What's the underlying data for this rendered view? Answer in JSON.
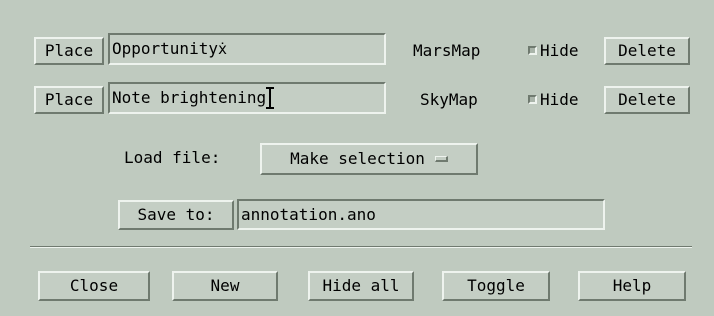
{
  "rows": [
    {
      "place_label": "Place",
      "annotation_text": "Opportunity",
      "map_label": "MarsMap",
      "hide_label": "Hide",
      "delete_label": "Delete"
    },
    {
      "place_label": "Place",
      "annotation_text": "Note brightening",
      "map_label": "SkyMap",
      "hide_label": "Hide",
      "delete_label": "Delete"
    }
  ],
  "load": {
    "label": "Load file:",
    "selection": "Make selection"
  },
  "save": {
    "button_label": "Save to:",
    "filename": "annotation.ano"
  },
  "footer": {
    "close": "Close",
    "new": "New",
    "hide_all": "Hide all",
    "toggle": "Toggle",
    "help": "Help"
  },
  "colors": {
    "background": "#bfcabf",
    "highlight": "#eef3ee",
    "shadow": "#6f7a6f"
  },
  "icons": {
    "text_cursor_row1": "x-text-cursor-icon",
    "text_cursor_row2": "i-beam-cursor-icon",
    "option_menu": "option-menu-indicator-icon"
  }
}
